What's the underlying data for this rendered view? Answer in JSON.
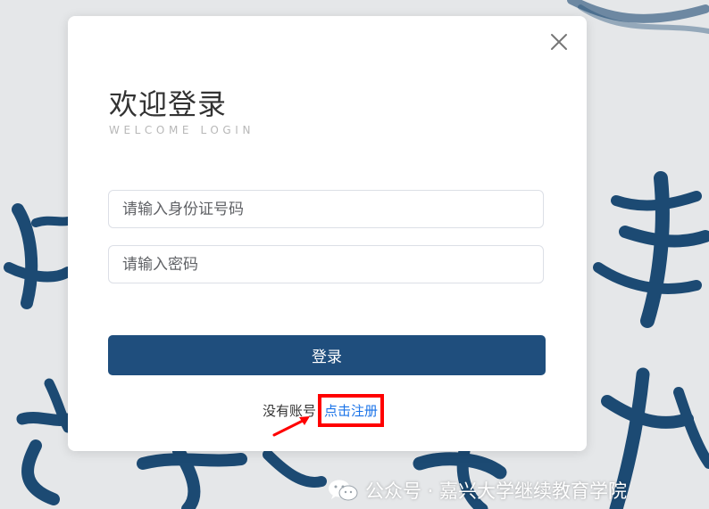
{
  "login_modal": {
    "title": "欢迎登录",
    "subtitle": "WELCOME LOGIN",
    "id_placeholder": "请输入身份证号码",
    "password_placeholder": "请输入密码",
    "login_button": "登录",
    "no_account_text": "没有账号",
    "register_link": "点击注册",
    "close_icon": "close-icon"
  },
  "annotations": {
    "highlight_color": "#ff0000",
    "arrow_color": "#ff0000"
  },
  "watermark": {
    "text": "公众号 · 嘉兴大学继续教育学院",
    "icon": "wechat-icon"
  },
  "colors": {
    "primary_button": "#1f4e7d",
    "link": "#1a73e8",
    "calligraphy": "#1c4a73"
  }
}
